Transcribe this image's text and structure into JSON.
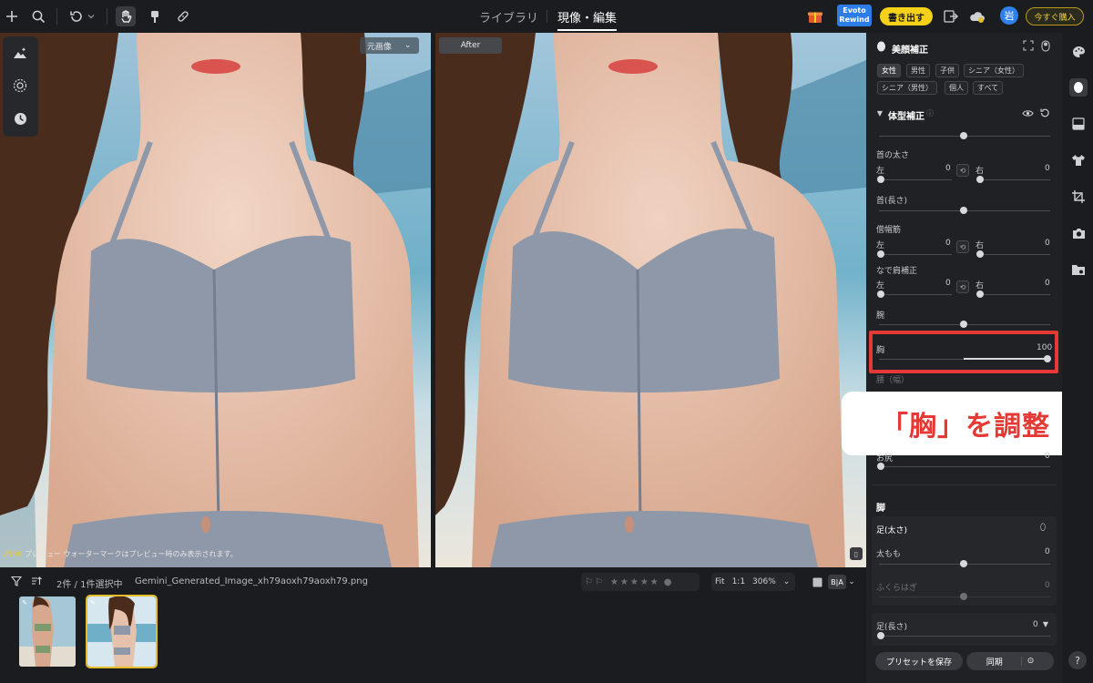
{
  "topbar": {
    "tabs": [
      "ライブラリ",
      "現像・編集"
    ],
    "active_tab": "現像・編集",
    "evoto_badge": [
      "Evoto",
      "Rewind"
    ],
    "export_label": "書き出す",
    "avatar_label": "岩",
    "buy_label": "今すぐ購入"
  },
  "preview": {
    "left_tag": "元画像",
    "right_tag": "After",
    "note_prefix": "4596",
    "note_text": "プレビュー ウォーターマークはプレビュー時のみ表示されます。"
  },
  "bottom": {
    "count_label": "2件 / 1件選択中",
    "filename": "Gemini_Generated_Image_xh79aoxh79aoxh79.png",
    "rating": "★★★★★",
    "fit_label": "Fit",
    "ratio_label": "1:1",
    "zoom_label": "306%",
    "compare_label": "B|A"
  },
  "panel": {
    "section_title": "美顔補正",
    "chips_row1": [
      "女性",
      "男性",
      "子供",
      "シニア（女性）"
    ],
    "chips_row2": [
      "シニア（男性）",
      "個人",
      "すべて"
    ],
    "active_chip": "女性",
    "body_section": "体型補正",
    "neck_thickness": "首の太さ",
    "left_label": "左",
    "right_label": "右",
    "neck_left_value": "0",
    "neck_right_value": "0",
    "neck_length": "首(長さ)",
    "shoulder_muscle": "僧帽筋",
    "shoulder_left_value": "0",
    "shoulder_right_value": "0",
    "slope_shoulder": "なで肩補正",
    "slope_left_value": "0",
    "slope_right_value": "0",
    "arm": "腕",
    "chest": "胸",
    "chest_value": "100",
    "waist_partial": "腰（幅）",
    "hip_label": "お尻",
    "hip_value": "0",
    "legs_section": "脚",
    "legs_thickness": "足(太さ)",
    "thigh": "太もも",
    "thigh_value": "0",
    "calf": "ふくらはぎ",
    "calf_value": "0",
    "legs_length": "足(長さ)",
    "legs_length_value": "0",
    "save_preset": "プリセットを保存",
    "sync": "同期"
  },
  "callout": "「胸」を調整",
  "colors": {
    "accent_yellow": "#f6d11a",
    "highlight_red": "#e53935",
    "avatar_blue": "#2f80ed"
  }
}
